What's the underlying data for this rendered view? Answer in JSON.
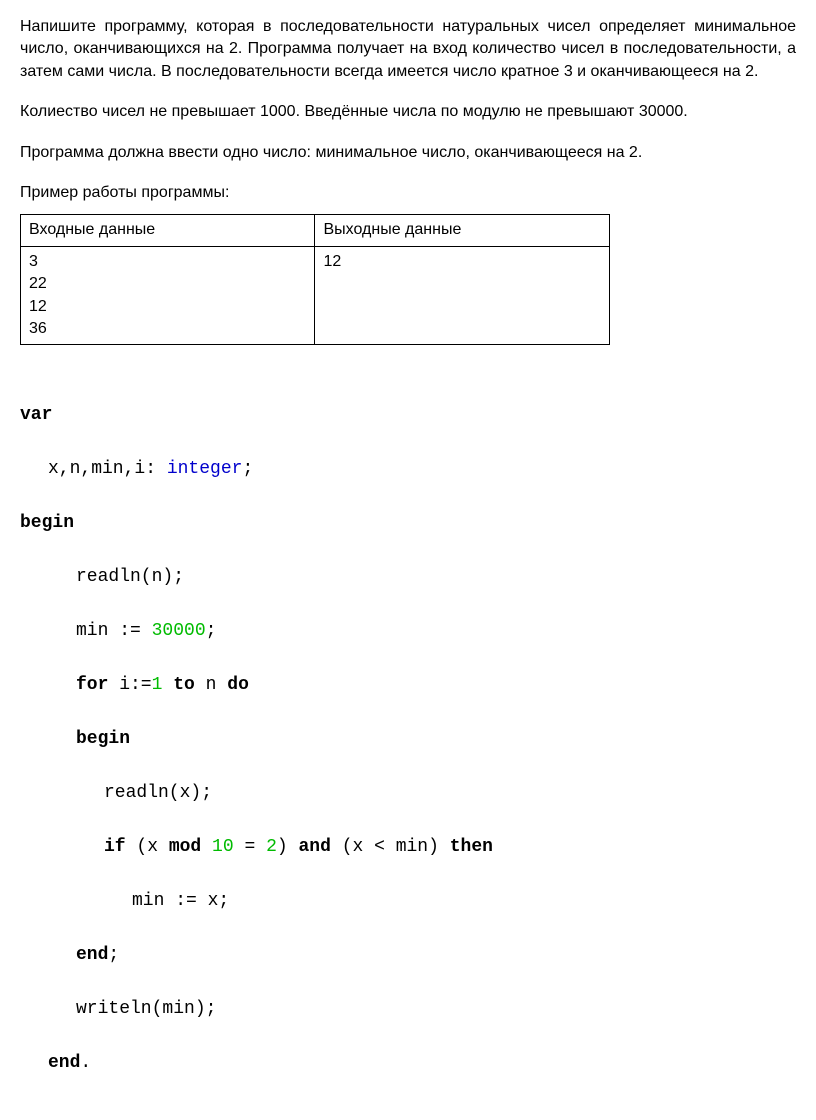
{
  "problem": {
    "para1": "Напишите программу, которая в последовательности натуральных чисел определяет минимальное число, оканчивающихся на 2. Программа получает на вход количество чисел в последовательности, а затем сами числа. В последовательности всегда имеется число кратное 3 и оканчивающееся на 2.",
    "para2": "Колиество чисел не превышает 1000. Введённые числа по модулю не превышают 30000.",
    "para3": "Программа должна ввести одно число: минимальное число, оканчивающееся на 2.",
    "example_label": "Пример работы программы:"
  },
  "table": {
    "header_input": "Входные данные",
    "header_output": "Выходные данные",
    "input_data": "3\n22\n12\n36",
    "output_data": "12"
  },
  "code": {
    "var": "var",
    "decl_pre": "x,n,min,i: ",
    "decl_type": "integer",
    "decl_post": ";",
    "begin": "begin",
    "readln_n": "readln(n);",
    "min_pre": "min := ",
    "min_num": "30000",
    "min_post": ";",
    "for": "for",
    "for_mid1": " i:=",
    "for_num1": "1",
    "for_mid2": " ",
    "to": "to",
    "for_mid3": " n ",
    "do": "do",
    "begin2": "begin",
    "readln_x": "readln(x);",
    "if": "if",
    "if_mid1": " (x ",
    "mod": "mod",
    "if_mid2": " ",
    "if_num1": "10",
    "if_mid3": " = ",
    "if_num2": "2",
    "if_mid4": ") ",
    "and": "and",
    "if_mid5": " (x < min) ",
    "then": "then",
    "min_assign": "min := x;",
    "end1": "end",
    "end1_post": ";",
    "writeln": "writeln(min);",
    "end2": "end",
    "end2_post": "."
  }
}
